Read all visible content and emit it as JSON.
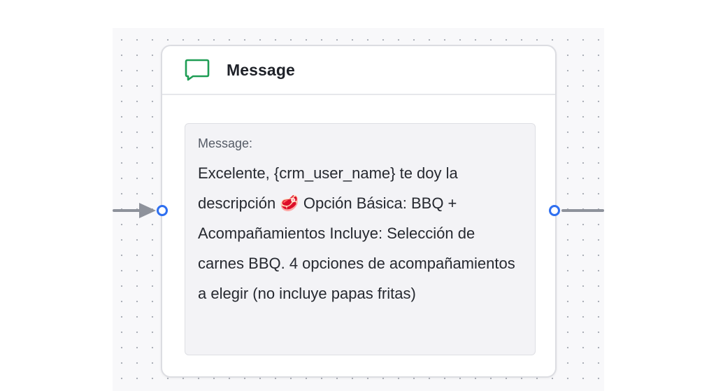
{
  "node": {
    "icon": "chat-bubble-icon",
    "title": "Message",
    "accent_color": "#1f9d55",
    "message_label": "Message:",
    "message_text": "Excelente, {crm_user_name} te doy la descripción 🥩 Opción Básica: BBQ + Acompañamientos Incluye: Selección de carnes BBQ. 4 opciones de acompañamientos a elegir (no incluye papas fritas)"
  },
  "colors": {
    "handle": "#2e6ff0",
    "edge": "#8e929b",
    "canvas": "#f8f8fa"
  }
}
